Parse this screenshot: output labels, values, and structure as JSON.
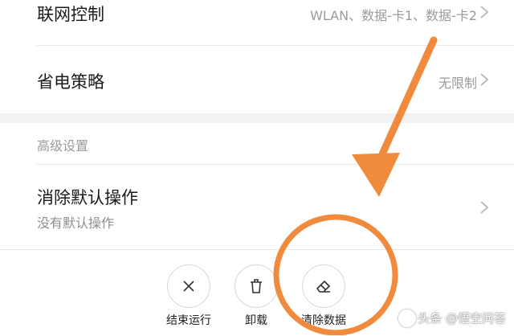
{
  "rows": {
    "network": {
      "title": "联网控制",
      "value": "WLAN、数据-卡1、数据-卡2"
    },
    "power": {
      "title": "省电策略",
      "value": "无限制"
    }
  },
  "section_header": "高级设置",
  "default_ops": {
    "title": "消除默认操作",
    "subtitle": "没有默认操作"
  },
  "actions": [
    {
      "label": "结束运行",
      "icon": "close-icon"
    },
    {
      "label": "卸载",
      "icon": "trash-icon"
    },
    {
      "label": "清除数据",
      "icon": "eraser-icon"
    }
  ],
  "annotation": {
    "color": "#f08a3c"
  },
  "watermark": "头条 @悟空问答"
}
